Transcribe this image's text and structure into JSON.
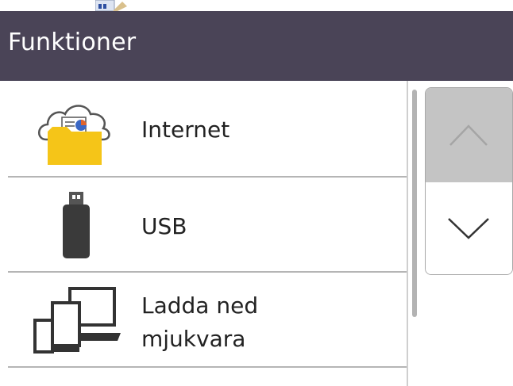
{
  "header": {
    "title": "Funktioner"
  },
  "menu": {
    "items": [
      {
        "label": "Internet",
        "icon": "cloud-folder-icon"
      },
      {
        "label": "USB",
        "icon": "usb-drive-icon"
      },
      {
        "label_line1": "Ladda ned",
        "label_line2": "mjukvara",
        "icon": "devices-icon"
      }
    ]
  },
  "scroll": {
    "up_icon": "chevron-up-icon",
    "down_icon": "chevron-down-icon"
  },
  "colors": {
    "header_bg": "#4a4457",
    "folder_yellow": "#f5c518",
    "scroll_up_bg": "#c4c4c4"
  }
}
